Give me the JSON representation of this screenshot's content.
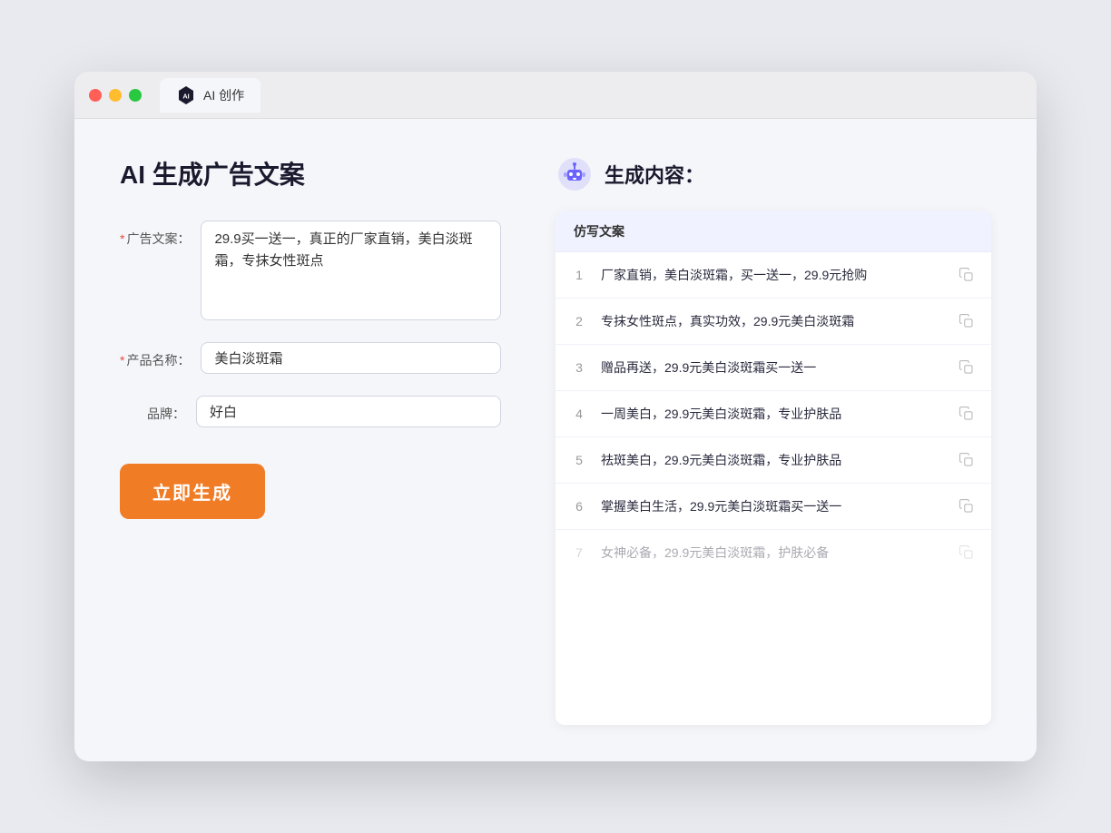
{
  "tab": {
    "label": "AI 创作"
  },
  "left": {
    "title": "AI 生成广告文案",
    "fields": [
      {
        "id": "ad-copy",
        "label": "广告文案：",
        "required": true,
        "type": "textarea",
        "value": "29.9买一送一，真正的厂家直销，美白淡斑霜，专抹女性斑点"
      },
      {
        "id": "product-name",
        "label": "产品名称：",
        "required": true,
        "type": "input",
        "value": "美白淡斑霜"
      },
      {
        "id": "brand",
        "label": "品牌：",
        "required": false,
        "type": "input",
        "value": "好白"
      }
    ],
    "button_label": "立即生成"
  },
  "right": {
    "title": "生成内容：",
    "column_header": "仿写文案",
    "results": [
      {
        "number": "1",
        "text": "厂家直销，美白淡斑霜，买一送一，29.9元抢购",
        "faded": false
      },
      {
        "number": "2",
        "text": "专抹女性斑点，真实功效，29.9元美白淡斑霜",
        "faded": false
      },
      {
        "number": "3",
        "text": "赠品再送，29.9元美白淡斑霜买一送一",
        "faded": false
      },
      {
        "number": "4",
        "text": "一周美白，29.9元美白淡斑霜，专业护肤品",
        "faded": false
      },
      {
        "number": "5",
        "text": "祛斑美白，29.9元美白淡斑霜，专业护肤品",
        "faded": false
      },
      {
        "number": "6",
        "text": "掌握美白生活，29.9元美白淡斑霜买一送一",
        "faded": false
      },
      {
        "number": "7",
        "text": "女神必备，29.9元美白淡斑霜，护肤必备",
        "faded": true
      }
    ]
  }
}
